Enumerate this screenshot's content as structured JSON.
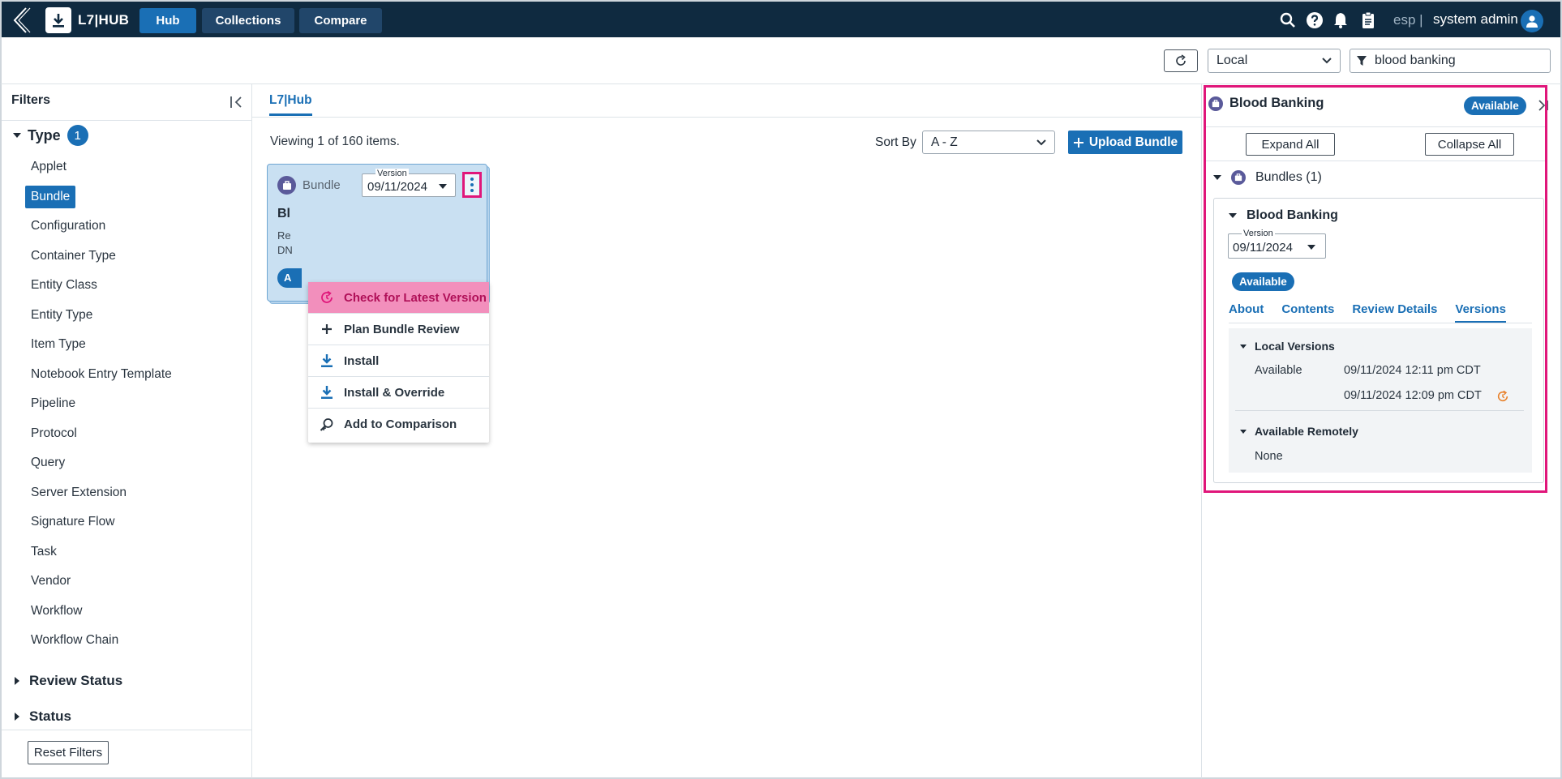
{
  "topbar": {
    "brand": "L7|HUB",
    "nav": {
      "hub": "Hub",
      "collections": "Collections",
      "compare": "Compare"
    },
    "tenant": "esp |",
    "user": "system admin"
  },
  "toolbar": {
    "source_select": "Local",
    "filter_value": "blood banking"
  },
  "filters": {
    "title": "Filters",
    "type_label": "Type",
    "type_count": "1",
    "types": [
      "Applet",
      "Bundle",
      "Configuration",
      "Container Type",
      "Entity Class",
      "Entity Type",
      "Item Type",
      "Notebook Entry Template",
      "Pipeline",
      "Protocol",
      "Query",
      "Server Extension",
      "Signature Flow",
      "Task",
      "Vendor",
      "Workflow",
      "Workflow Chain"
    ],
    "selected_type": "Bundle",
    "review_status": "Review Status",
    "status": "Status",
    "reset": "Reset Filters"
  },
  "main": {
    "tab": "L7|Hub",
    "viewing": "Viewing 1 of 160 items.",
    "sort_label": "Sort By",
    "sort_value": "A - Z",
    "upload": "Upload Bundle",
    "card": {
      "type": "Bundle",
      "version_label": "Version",
      "version": "09/11/2024",
      "title": "Bl",
      "line1": "Re",
      "line2": "DN",
      "badge": "A"
    },
    "menu": [
      "Check for Latest Version",
      "Plan Bundle Review",
      "Install",
      "Install & Override",
      "Add to Comparison"
    ]
  },
  "details": {
    "title": "Blood Banking",
    "status": "Available",
    "expand_all": "Expand All",
    "collapse_all": "Collapse All",
    "bundles_head": "Bundles (1)",
    "bundle_title": "Blood Banking",
    "version_label": "Version",
    "version": "09/11/2024",
    "bundle_status": "Available",
    "tabs": [
      "About",
      "Contents",
      "Review Details",
      "Versions"
    ],
    "active_tab": "Versions",
    "local_versions": "Local Versions",
    "local_status": "Available",
    "local_v1": "09/11/2024 12:11 pm CDT",
    "local_v2": "09/11/2024 12:09 pm CDT",
    "remote_head": "Available Remotely",
    "remote_value": "None"
  },
  "colors": {
    "topbar": "#0f2a40",
    "accent": "#1a6fb5",
    "highlight": "#e0167a",
    "menu_highlight": "#f28fbc",
    "update_icon": "#e8802a"
  }
}
